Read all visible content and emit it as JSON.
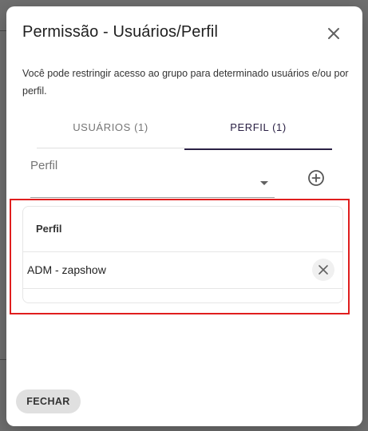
{
  "dialog": {
    "title": "Permissão - Usuários/Perfil",
    "description": "Você pode restringir acesso ao grupo para determinado usuários e/ou por perfil."
  },
  "tabs": [
    {
      "label": "USUÁRIOS (1)",
      "active": false
    },
    {
      "label": "PERFIL (1)",
      "active": true
    }
  ],
  "profile_select": {
    "label": "Perfil",
    "value": ""
  },
  "table": {
    "header": "Perfil",
    "rows": [
      {
        "name": "ADM - zapshow"
      }
    ]
  },
  "footer": {
    "close_label": "FECHAR"
  },
  "colors": {
    "accent": "#2a2044",
    "highlight": "#e01e1e",
    "button_bg": "#e0e0e0"
  },
  "icons": {
    "close": "close-icon",
    "add": "add-circle-icon",
    "remove": "remove-icon",
    "dropdown": "dropdown-arrow-icon"
  }
}
